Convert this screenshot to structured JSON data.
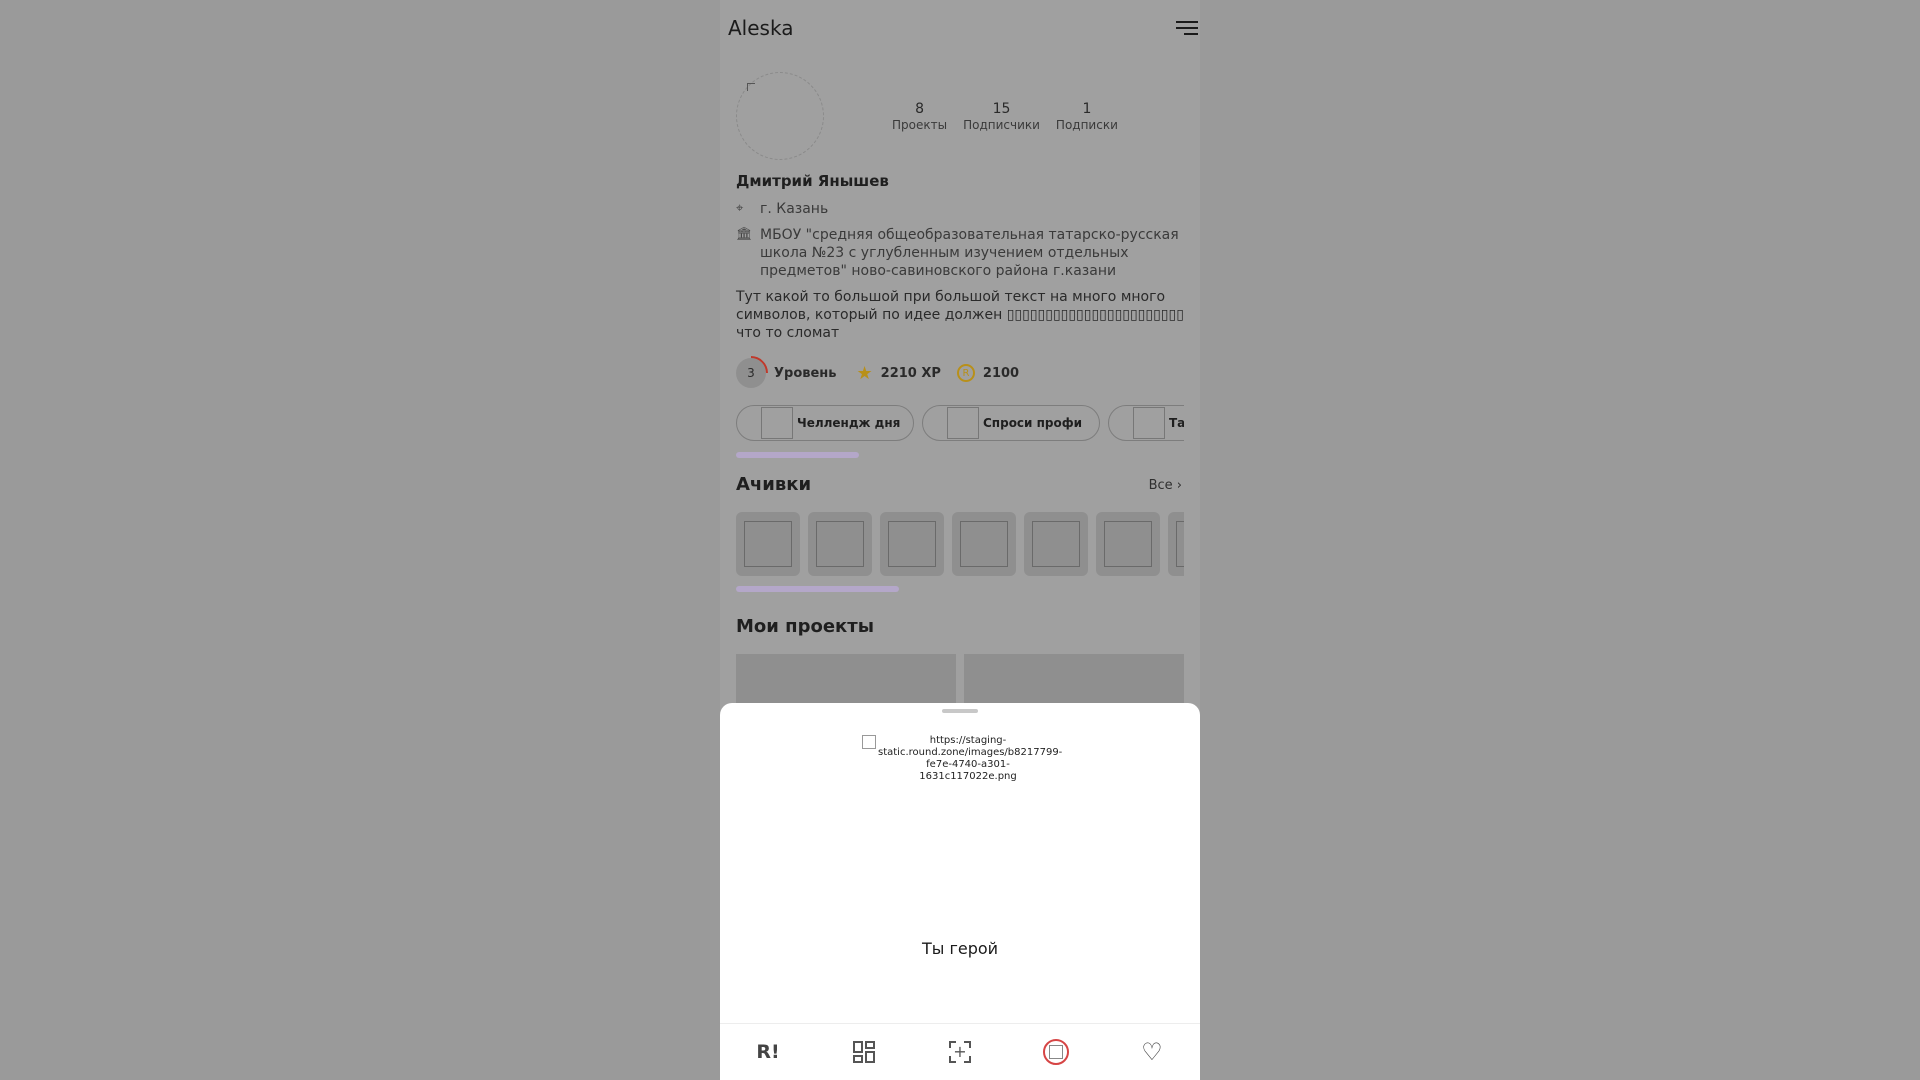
{
  "header": {
    "brand": "Aleska"
  },
  "profile": {
    "stats": [
      {
        "value": "8",
        "label": "Проекты"
      },
      {
        "value": "15",
        "label": "Подписчики"
      },
      {
        "value": "1",
        "label": "Подписки"
      }
    ],
    "name": "Дмитрий Янышев",
    "city": "г. Казань",
    "school": "МБОУ \"средняя общеобразовательная татарско-русская школа №23 с углубленным изучением отдельных предметов\" ново-савиновского района г.казани",
    "bio": "Тут какой то большой при большой текст на много много символов, который по идее должен ▯▯▯▯▯▯▯▯▯▯▯▯▯▯▯▯▯▯▯▯▯▯▯ что то сломат"
  },
  "level": {
    "number": "3",
    "label": "Уровень",
    "xp": "2210 XP",
    "coins": "2100",
    "coin_symbol": "R"
  },
  "chips": [
    {
      "label": "Челлендж дня"
    },
    {
      "label": "Спроси профи"
    },
    {
      "label": "Та"
    }
  ],
  "achievements": {
    "title": "Ачивки",
    "all_link": "Все ›",
    "count": 7
  },
  "projects": {
    "title": "Мои проекты"
  },
  "sheet": {
    "image_alt": "https://staging-static.round.zone/images/b8217799-fe7e-4740-a301-1631c117022e.png",
    "text": "Ты герой"
  },
  "nav": {
    "logo": "R!"
  }
}
